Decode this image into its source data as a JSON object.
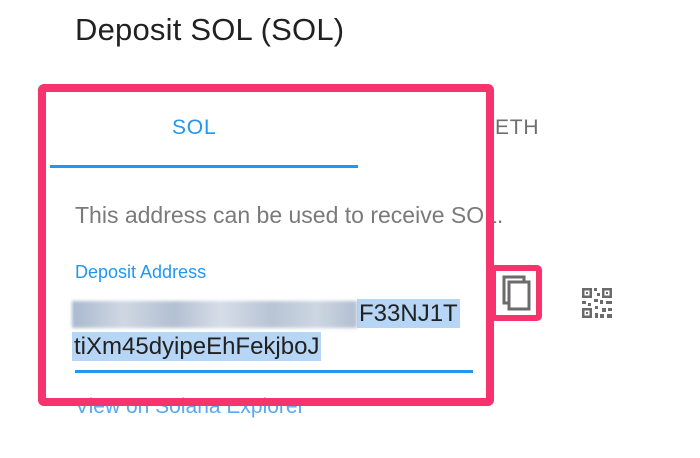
{
  "page": {
    "title": "Deposit SOL (SOL)"
  },
  "tabs": [
    {
      "label": "SOL",
      "active": true
    },
    {
      "label": "ETH",
      "active": false
    }
  ],
  "deposit": {
    "description": "This address can be used to receive SOL.",
    "field_label": "Deposit Address",
    "address_visible_end_line1": "F33NJ1T",
    "address_line2": "tiXm45dyipeEhFekjboJ",
    "address_redacted": true
  },
  "actions": {
    "copy_icon": "copy-icon",
    "qr_icon": "qr-code-icon"
  },
  "link": {
    "explorer_label": "View on Solana Explorer"
  },
  "colors": {
    "accent": "#2196f3",
    "highlight": "#f7336e",
    "selection": "#b7d5f5"
  }
}
